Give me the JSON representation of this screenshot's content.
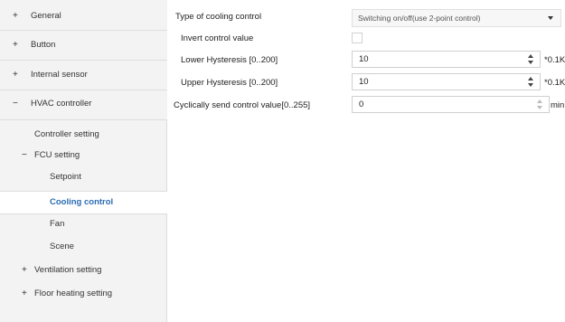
{
  "sidebar": {
    "items": [
      {
        "symbol": "+",
        "label": "General"
      },
      {
        "symbol": "+",
        "label": "Button"
      },
      {
        "symbol": "+",
        "label": "Internal sensor"
      },
      {
        "symbol": "−",
        "label": "HVAC controller"
      }
    ],
    "sub_items": [
      {
        "symbol": "",
        "label": "Controller setting"
      },
      {
        "symbol": "−",
        "label": "FCU setting"
      },
      {
        "symbol": "",
        "label": "Setpoint"
      },
      {
        "symbol": "",
        "label": "Cooling control"
      },
      {
        "symbol": "",
        "label": "Fan"
      },
      {
        "symbol": "",
        "label": "Scene"
      },
      {
        "symbol": "+",
        "label": "Ventilation setting"
      },
      {
        "symbol": "+",
        "label": "Floor heating setting"
      }
    ],
    "selected": "Cooling control"
  },
  "main": {
    "type_label": "Type of cooling control",
    "type_value": "Switching on/off(use 2-point control)",
    "invert_label": "Invert control value",
    "invert_checked": false,
    "lower_label": "Lower Hysteresis [0..200]",
    "lower_value": "10",
    "lower_unit": "*0.1K",
    "upper_label": "Upper Hysteresis [0..200]",
    "upper_value": "10",
    "upper_unit": "*0.1K",
    "cyclic_label": "Cyclically send control value[0..255]",
    "cyclic_value": "0",
    "cyclic_unit": "min"
  },
  "icons": {
    "expand": "plus-icon",
    "collapse": "minus-icon",
    "dropdown": "chevron-down-icon",
    "spin": "spin-arrows-icon"
  }
}
